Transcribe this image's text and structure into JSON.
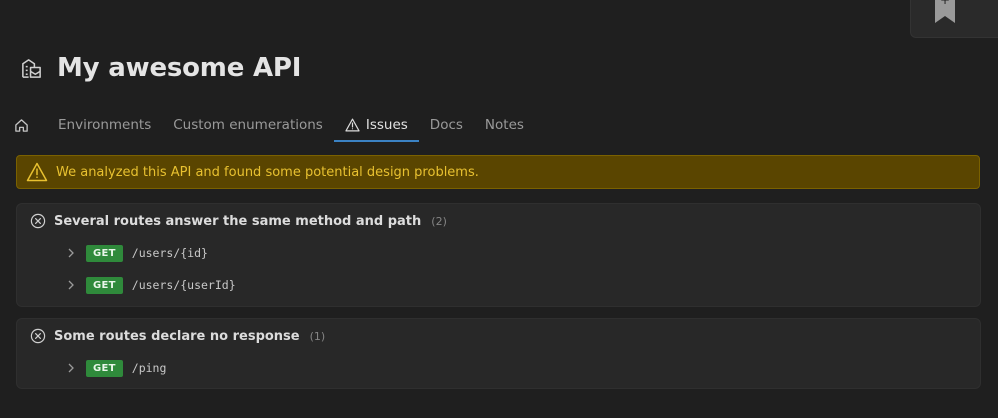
{
  "corner": {
    "plus": "+"
  },
  "header": {
    "title": "My awesome API",
    "icon": "api-building-icon"
  },
  "tabs": [
    {
      "label": "",
      "icon": "home-icon",
      "active": false
    },
    {
      "label": "Environments",
      "active": false
    },
    {
      "label": "Custom enumerations",
      "active": false
    },
    {
      "label": "Issues",
      "icon": "warning-icon",
      "active": true
    },
    {
      "label": "Docs",
      "active": false
    },
    {
      "label": "Notes",
      "active": false
    }
  ],
  "banner": {
    "message": "We analyzed this API and found some potential design problems."
  },
  "issues": [
    {
      "title": "Several routes answer the same method and path",
      "count": "(2)",
      "routes": [
        {
          "method": "GET",
          "path": "/users/{id}"
        },
        {
          "method": "GET",
          "path": "/users/{userId}"
        }
      ]
    },
    {
      "title": "Some routes declare no response",
      "count": "(1)",
      "routes": [
        {
          "method": "GET",
          "path": "/ping"
        }
      ]
    }
  ],
  "colors": {
    "accent": "#3b82c4",
    "warning_bg": "#5a4500",
    "warning_text": "#e8c130",
    "get": "#2f8a3b"
  }
}
